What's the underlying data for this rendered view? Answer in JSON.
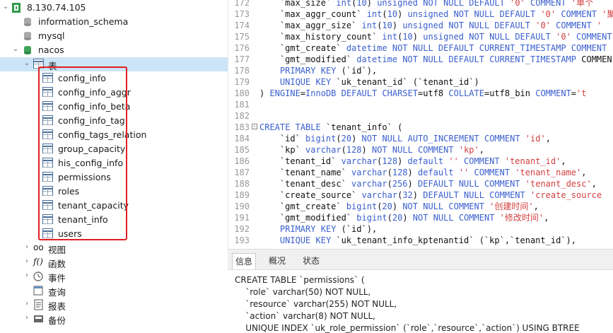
{
  "tree": {
    "connection": "8.130.74.105",
    "databases": [
      "information_schema",
      "mysql",
      "nacos"
    ],
    "tables_node": "表",
    "tables": [
      "config_info",
      "config_info_aggr",
      "config_info_beta",
      "config_info_tag",
      "config_tags_relation",
      "group_capacity",
      "his_config_info",
      "permissions",
      "roles",
      "tenant_capacity",
      "tenant_info",
      "users"
    ],
    "views": "视图",
    "functions": "函数",
    "events": "事件",
    "queries": "查询",
    "reports": "报表",
    "backups": "备份"
  },
  "editor": {
    "lines": [
      {
        "n": "172",
        "code": "    `max_size` int(10) unsigned NOT NULL DEFAULT '0' COMMENT '单个"
      },
      {
        "n": "173",
        "code": "    `max_aggr_count` int(10) unsigned NOT NULL DEFAULT '0' COMMENT '聚"
      },
      {
        "n": "174",
        "code": "    `max_aggr_size` int(10) unsigned NOT NULL DEFAULT '0' COMMENT '"
      },
      {
        "n": "175",
        "code": "    `max_history_count` int(10) unsigned NOT NULL DEFAULT '0' COMMENT"
      },
      {
        "n": "176",
        "code": "    `gmt_create` datetime NOT NULL DEFAULT CURRENT_TIMESTAMP COMMENT"
      },
      {
        "n": "177",
        "code": "    `gmt_modified` datetime NOT NULL DEFAULT CURRENT_TIMESTAMP COMMEN"
      },
      {
        "n": "178",
        "code": "    PRIMARY KEY (`id`),"
      },
      {
        "n": "179",
        "code": "    UNIQUE KEY `uk_tenant_id` (`tenant_id`)"
      },
      {
        "n": "180",
        "code": ") ENGINE=InnoDB DEFAULT CHARSET=utf8 COLLATE=utf8_bin COMMENT='t"
      },
      {
        "n": "181",
        "code": ""
      },
      {
        "n": "182",
        "code": ""
      },
      {
        "n": "183",
        "code": "CREATE TABLE `tenant_info` (",
        "fold": true
      },
      {
        "n": "184",
        "code": "    `id` bigint(20) NOT NULL AUTO_INCREMENT COMMENT 'id',"
      },
      {
        "n": "185",
        "code": "    `kp` varchar(128) NOT NULL COMMENT 'kp',"
      },
      {
        "n": "186",
        "code": "    `tenant_id` varchar(128) default '' COMMENT 'tenant_id',"
      },
      {
        "n": "187",
        "code": "    `tenant_name` varchar(128) default '' COMMENT 'tenant_name',"
      },
      {
        "n": "188",
        "code": "    `tenant_desc` varchar(256) DEFAULT NULL COMMENT 'tenant_desc',"
      },
      {
        "n": "189",
        "code": "    `create_source` varchar(32) DEFAULT NULL COMMENT 'create_source"
      },
      {
        "n": "190",
        "code": "    `gmt_create` bigint(20) NOT NULL COMMENT '创建时间',"
      },
      {
        "n": "191",
        "code": "    `gmt_modified` bigint(20) NOT NULL COMMENT '修改时间',"
      },
      {
        "n": "192",
        "code": "    PRIMARY KEY (`id`),"
      },
      {
        "n": "193",
        "code": "    UNIQUE KEY `uk_tenant_info_kptenantid` (`kp`,`tenant_id`),"
      }
    ],
    "colors": {
      "keyword": "#3a5fcd",
      "string": "#d23f3f",
      "text": "#111111"
    }
  },
  "bottom": {
    "tabs": [
      "信息",
      "概况",
      "状态"
    ],
    "ddl": [
      "CREATE TABLE `permissions` (",
      "    `role` varchar(50) NOT NULL,",
      "    `resource` varchar(255) NOT NULL,",
      "    `action` varchar(8) NOT NULL,",
      "    UNIQUE INDEX `uk_role_permission` (`role`,`resource`,`action`) USING BTREE"
    ]
  }
}
